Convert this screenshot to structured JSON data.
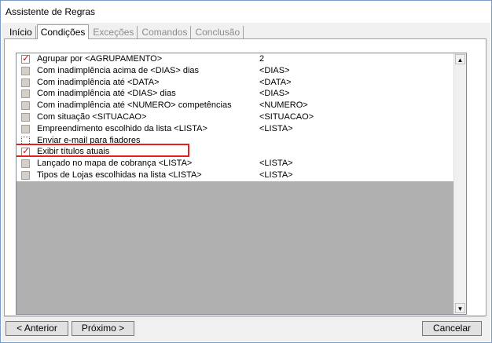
{
  "window": {
    "title": "Assistente de Regras"
  },
  "tabs": [
    {
      "label": "Início",
      "state": "normal"
    },
    {
      "label": "Condições",
      "state": "active"
    },
    {
      "label": "Exceções",
      "state": "disabled"
    },
    {
      "label": "Comandos",
      "state": "disabled"
    },
    {
      "label": "Conclusão",
      "state": "disabled"
    }
  ],
  "rules": [
    {
      "label": "Agrupar por <AGRUPAMENTO>",
      "value": "2",
      "checked": true
    },
    {
      "label": "Com inadimplência acima de <DIAS> dias",
      "value": "<DIAS>",
      "checked": false
    },
    {
      "label": "Com inadimplência até <DATA>",
      "value": "<DATA>",
      "checked": false
    },
    {
      "label": "Com inadimplência até <DIAS>  dias",
      "value": "<DIAS>",
      "checked": false
    },
    {
      "label": "Com inadimplência até <NUMERO> competências",
      "value": "<NUMERO>",
      "checked": false
    },
    {
      "label": "Com situação <SITUACAO>",
      "value": "<SITUACAO>",
      "checked": false
    },
    {
      "label": "Empreendimento escolhido da lista <LISTA>",
      "value": "<LISTA>",
      "checked": false
    },
    {
      "label": "Enviar e-mail para fiadores",
      "value": "",
      "checked": false,
      "focused": true
    },
    {
      "label": "Exibir títulos atuais",
      "value": "",
      "checked": true,
      "highlighted": true
    },
    {
      "label": "Lançado no mapa de cobrança <LISTA>",
      "value": "<LISTA>",
      "checked": false
    },
    {
      "label": "Tipos de Lojas escolhidas na lista <LISTA>",
      "value": "<LISTA>",
      "checked": false
    }
  ],
  "scroll": {
    "up_glyph": "▲",
    "down_glyph": "▼"
  },
  "buttons": {
    "prev": "< Anterior",
    "next": "Próximo >",
    "cancel": "Cancelar"
  },
  "colors": {
    "highlight": "#e32020",
    "check": "#d01010"
  }
}
